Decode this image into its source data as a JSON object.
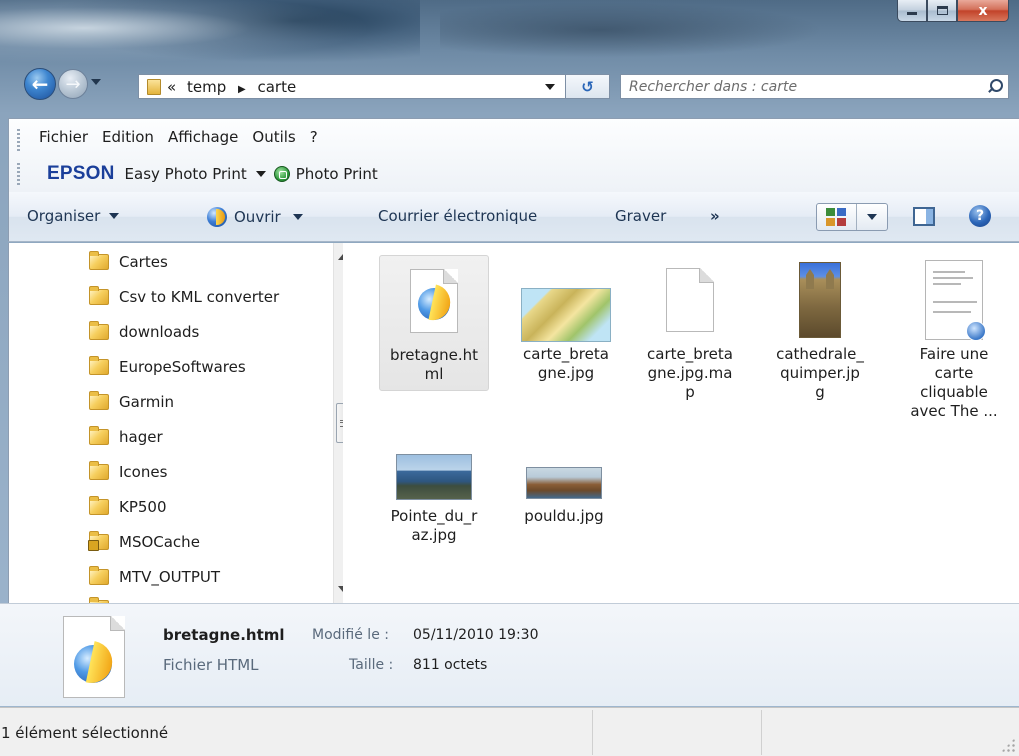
{
  "address": {
    "segments": [
      "«",
      "temp",
      "carte"
    ],
    "separator": "▶"
  },
  "search": {
    "placeholder": "Rechercher dans : carte"
  },
  "menu": {
    "items": [
      "Fichier",
      "Edition",
      "Affichage",
      "Outils",
      "?"
    ]
  },
  "epson": {
    "logo": "EPSON",
    "easy_photo_print": "Easy Photo Print",
    "photo_print": "Photo Print"
  },
  "toolbar": {
    "organiser": "Organiser",
    "ouvrir": "Ouvrir",
    "courrier": "Courrier électronique",
    "graver": "Graver",
    "more": "»"
  },
  "help_glyph": "?",
  "close_glyph": "x",
  "nav_back_glyph": "←",
  "nav_fwd_glyph": "→",
  "refresh_glyph": "↺",
  "sidebar": {
    "items": [
      {
        "label": "Cartes",
        "icon": "folder-icon"
      },
      {
        "label": "Csv to KML converter",
        "icon": "folder-icon"
      },
      {
        "label": "downloads",
        "icon": "folder-icon"
      },
      {
        "label": "EuropeSoftwares",
        "icon": "folder-icon"
      },
      {
        "label": "Garmin",
        "icon": "folder-icon"
      },
      {
        "label": "hager",
        "icon": "folder-icon"
      },
      {
        "label": "Icones",
        "icon": "folder-icon"
      },
      {
        "label": "KP500",
        "icon": "folder-icon"
      },
      {
        "label": "MSOCache",
        "icon": "locked-folder-icon"
      },
      {
        "label": "MTV_OUTPUT",
        "icon": "folder-icon"
      }
    ]
  },
  "files": [
    {
      "name": "bretagne.ht\nml",
      "icon": "html-file-icon",
      "selected": true
    },
    {
      "name": "carte_breta\ngne.jpg",
      "icon": "map-image-thumbnail",
      "selected": false
    },
    {
      "name": "carte_breta\ngne.jpg.ma\np",
      "icon": "blank-file-icon",
      "selected": false
    },
    {
      "name": "cathedrale_\nquimper.jp\ng",
      "icon": "cathedral-image-thumbnail",
      "selected": false
    },
    {
      "name": "Faire une\ncarte\ncliquable\navec The ...",
      "icon": "document-thumbnail",
      "selected": false
    },
    {
      "name": "Pointe_du_r\naz.jpg",
      "icon": "coast-image-thumbnail",
      "selected": false
    },
    {
      "name": "pouldu.jpg",
      "icon": "beach-image-thumbnail",
      "selected": false
    }
  ],
  "details": {
    "name": "bretagne.html",
    "type": "Fichier HTML",
    "modified_label": "Modifié le :",
    "modified_value": "05/11/2010 19:30",
    "size_label": "Taille :",
    "size_value": "811 octets"
  },
  "status": {
    "text": "1 élément sélectionné"
  }
}
